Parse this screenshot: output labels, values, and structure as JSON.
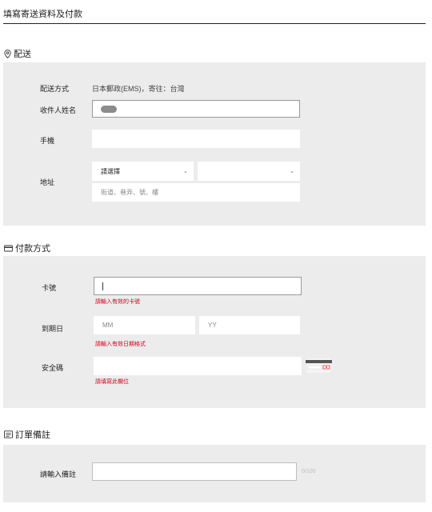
{
  "page": {
    "title": "填寫寄送資料及付款"
  },
  "shipping": {
    "heading": "配送",
    "method_label": "配送方式",
    "method_value": "日本郵政(EMS)，寄往：台灣",
    "name_label": "收件人姓名",
    "phone_label": "手機",
    "address_label": "地址",
    "select_placeholder": "請選擇",
    "second_select_value": "",
    "street_placeholder": "街道、巷弄、號、樓"
  },
  "payment": {
    "heading": "付款方式",
    "card_label": "卡號",
    "card_error": "請輸入有效的卡號",
    "expiry_label": "到期日",
    "month_placeholder": "MM",
    "year_placeholder": "YY",
    "expiry_error": "請輸入有效日期格式",
    "cvc_label": "安全碼",
    "cvc_error": "請填寫此欄位"
  },
  "notes": {
    "heading": "訂單備註",
    "note_label": "請輸入備註",
    "counter": "0/100"
  },
  "colors": {
    "error": "#d0021b",
    "panel": "#ececec",
    "accent": "#e53935"
  },
  "icons": [
    "location-pin-icon",
    "credit-card-icon",
    "notes-icon",
    "chevron-down-icon",
    "card-back-cvc-icon"
  ]
}
